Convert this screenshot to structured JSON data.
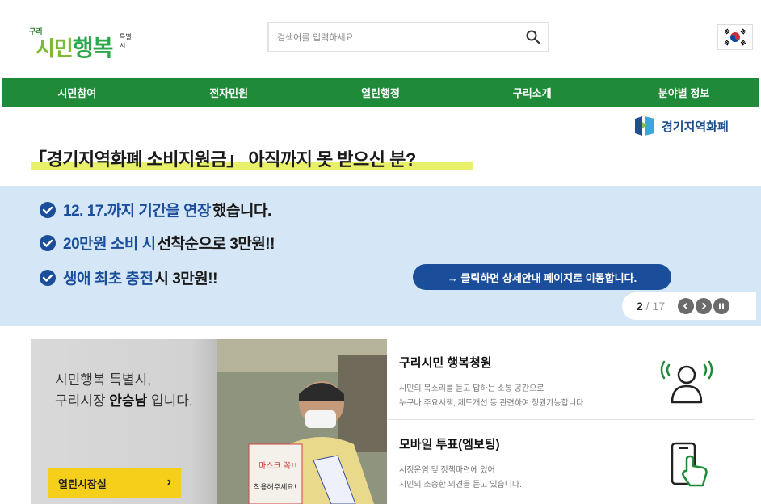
{
  "header": {
    "logo": {
      "small": "구리",
      "main": "시민행복",
      "tag": "특별시"
    },
    "search_placeholder": "검색어를 입력하세요."
  },
  "nav": [
    "시민참여",
    "전자민원",
    "열린행정",
    "구리소개",
    "분야별 정보"
  ],
  "banner": {
    "brand": "경기지역화폐",
    "headline": "「경기지역화폐 소비지원금」 아직까지 못 받으신 분?",
    "bullets": [
      {
        "blue": "12. 17.까지 기간을 연장",
        "dark": "했습니다."
      },
      {
        "blue": "20만원 소비 시 ",
        "dark": "선착순으로 3만원!!"
      },
      {
        "blue": "생애 최초 충전 ",
        "dark": "시 3만원!!"
      }
    ],
    "cta": "→ 클릭하면 상세안내 페이지로 이동합니다.",
    "pager": {
      "current": "2",
      "sep": " / ",
      "total": "17"
    }
  },
  "mayor": {
    "line1": "시민행복 특별시,",
    "line2_prefix": "구리시장 ",
    "line2_name": "안승남",
    "line2_suffix": " 입니다.",
    "button": "열린시장실"
  },
  "cards": [
    {
      "title": "구리시민 행복청원",
      "desc1": "시민의 목소리를 듣고 답하는 소통 공간으로",
      "desc2": "누구나 주요시책, 제도개선 등 관련하여 청원가능합니다."
    },
    {
      "title": "모바일 투표(엠보팅)",
      "desc1": "시정운영 및 정책마련에 있어",
      "desc2": "시민의 소중한 의견을 듣고 있습니다."
    }
  ],
  "colors": {
    "nav_green": "#1f8a38",
    "banner_blue": "#d5e6f6",
    "accent_blue": "#1b4e9a",
    "mayor_button": "#f5cf1a"
  }
}
